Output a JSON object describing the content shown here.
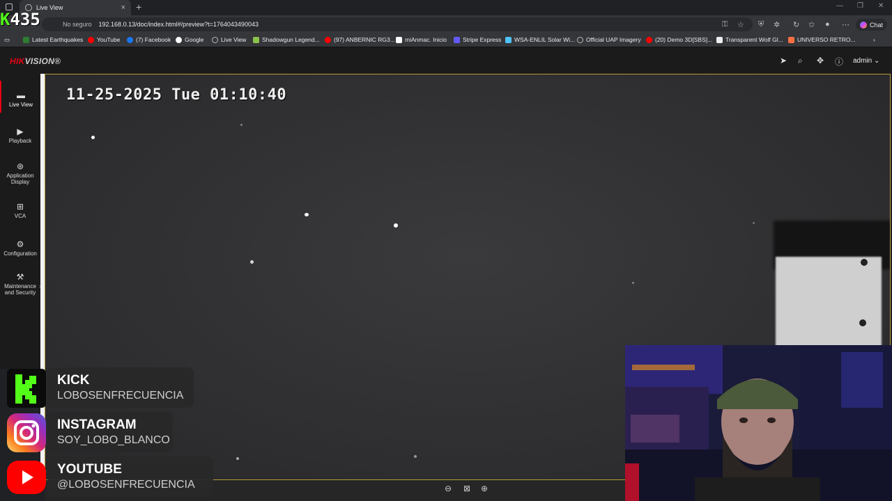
{
  "browser": {
    "tab_title": "Live View",
    "address_security": "No seguro",
    "url": "192.168.0.13/doc/index.html#/preview?t=1764043490043",
    "chat_label": "Chat",
    "bookmarks": [
      "Latest Earthquakes",
      "YouTube",
      "(7) Facebook",
      "Google",
      "Live View",
      "Shadowgun Legend...",
      "(97) ANBERNIC RG3...",
      "miAnmac. Inicio",
      "Stripe Express",
      "WSA-ENLIL Solar Wi...",
      "Official UAP Imagery",
      "(20) Demo 3D[SBS]...",
      "Transparent Wolf Gl...",
      "UNIVERSO RETRO..."
    ]
  },
  "overlay": {
    "counter_k": "K",
    "counter_value": "435"
  },
  "hikvision": {
    "logo_brand": "HIK",
    "logo_rest": "VISION®",
    "user": "admin",
    "nav": [
      {
        "label": "Live View",
        "icon": "live-view-icon"
      },
      {
        "label": "Playback",
        "icon": "playback-icon"
      },
      {
        "label": "Application Display",
        "icon": "application-icon"
      },
      {
        "label": "VCA",
        "icon": "vca-icon"
      },
      {
        "label": "Configuration",
        "icon": "gear-icon"
      },
      {
        "label": "Maintenance and Security",
        "icon": "maintenance-icon"
      }
    ],
    "osd_timestamp": "11-25-2025 Tue 01:10:40"
  },
  "social": [
    {
      "title": "KICK",
      "handle": "LOBOSENFRECUENCIA",
      "color": "#53fc18"
    },
    {
      "title": "INSTAGRAM",
      "handle": "SOY_LOBO_BLANCO",
      "color": "#e1306c"
    },
    {
      "title": "YOUTUBE",
      "handle": "@LOBOSENFRECUENCIA",
      "color": "#ff0000"
    }
  ],
  "colors": {
    "hik_red": "#e60012",
    "frame_gold": "#b59a3a"
  }
}
